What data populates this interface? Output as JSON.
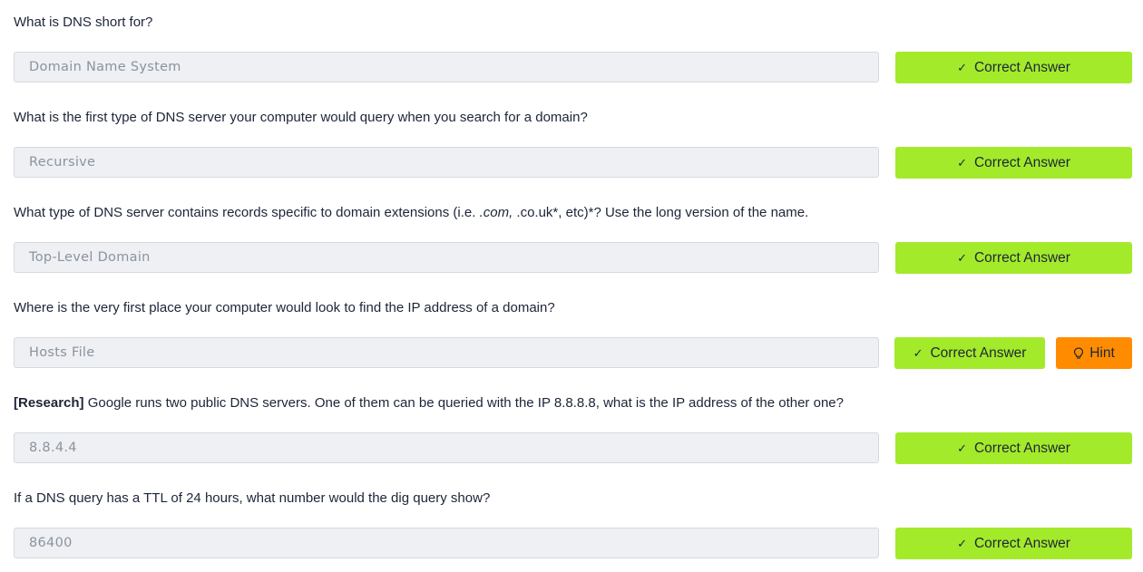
{
  "questions": [
    {
      "text": "What is DNS short for?",
      "answer": "Domain Name System",
      "button": "Correct Answer"
    },
    {
      "text": "What is the first type of DNS server your computer would query when you search for a domain?",
      "answer": "Recursive",
      "button": "Correct Answer"
    },
    {
      "text_before": "What type of DNS server contains records specific to domain extensions (i.e. ",
      "text_italic": ".com,",
      "text_after": " .co.uk*, etc)*? Use the long version of the name.",
      "answer": "Top-Level Domain",
      "button": "Correct Answer"
    },
    {
      "text": "Where is the very first place your computer would look to find the IP address of a domain?",
      "answer": "Hosts File",
      "button": "Correct Answer",
      "hint": "Hint"
    },
    {
      "text_bold": "[Research]",
      "text_after": " Google runs two public DNS servers. One of them can be queried with the IP 8.8.8.8, what is the IP address of the other one?",
      "answer": "8.8.4.4",
      "button": "Correct Answer"
    },
    {
      "text": "If a DNS query has a TTL of 24 hours, what number would the dig query show?",
      "answer": "86400",
      "button": "Correct Answer"
    }
  ],
  "icons": {
    "check": "check-icon",
    "hint": "lightbulb-icon"
  },
  "colors": {
    "correct": "#a3ea2a",
    "hint": "#ff8c00",
    "answer_bg": "#eef0f3"
  }
}
